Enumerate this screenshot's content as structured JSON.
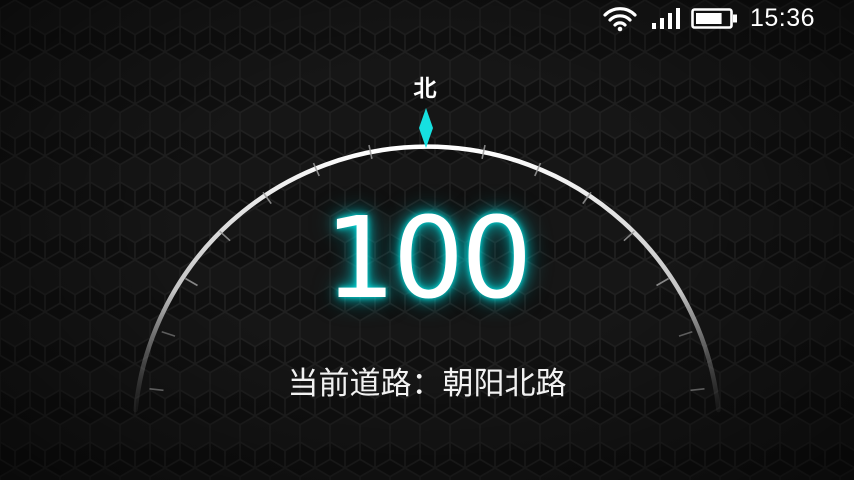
{
  "status_bar": {
    "icons": [
      "wifi-icon",
      "cellular-signal-icon",
      "battery-icon"
    ],
    "battery_level": 0.8,
    "time": "15:36"
  },
  "compass": {
    "direction_label": "北",
    "accent_color": "#16e0e0",
    "arc_color": "#ffffff"
  },
  "speed": {
    "value": "100",
    "glow_color": "#00e0e0"
  },
  "road": {
    "label": "当前道路",
    "separator": "：",
    "name": "朝阳北路"
  }
}
